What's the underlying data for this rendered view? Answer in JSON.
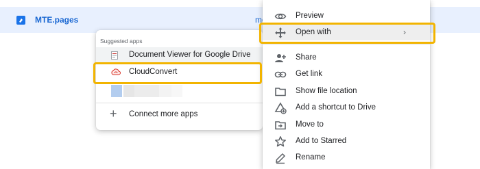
{
  "file": {
    "name": "MTE.pages",
    "owner": "me"
  },
  "submenu": {
    "header": "Suggested apps",
    "apps": [
      {
        "label": "Document Viewer for Google Drive",
        "icon": "document-viewer-icon"
      },
      {
        "label": "CloudConvert",
        "icon": "cloudconvert-icon"
      }
    ],
    "connect_label": "Connect more apps"
  },
  "menu": {
    "items": [
      {
        "label": "Preview",
        "icon": "eye-icon"
      },
      {
        "label": "Open with",
        "icon": "move-arrows-icon"
      },
      {
        "label": "Share",
        "icon": "add-person-icon"
      },
      {
        "label": "Get link",
        "icon": "link-icon"
      },
      {
        "label": "Show file location",
        "icon": "folder-icon"
      },
      {
        "label": "Add a shortcut to Drive",
        "icon": "add-shortcut-icon"
      },
      {
        "label": "Move to",
        "icon": "move-to-folder-icon"
      },
      {
        "label": "Add to Starred",
        "icon": "star-icon"
      },
      {
        "label": "Rename",
        "icon": "pencil-icon"
      }
    ],
    "open_with_chevron": "›"
  },
  "colors": {
    "highlight": "#f2b400",
    "selected_row": "#e8f0fe",
    "link_blue": "#1967d2"
  }
}
